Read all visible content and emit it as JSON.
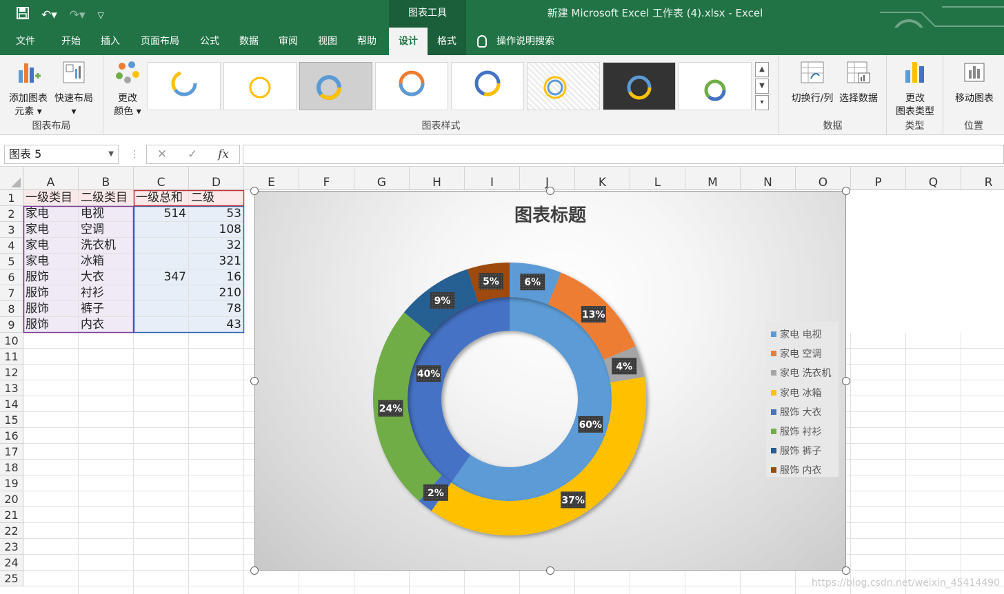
{
  "titlebar": {
    "context_tools": "图表工具",
    "document_title": "新建 Microsoft Excel 工作表 (4).xlsx  -  Excel"
  },
  "tabs": [
    {
      "label": "文件"
    },
    {
      "label": "开始"
    },
    {
      "label": "插入"
    },
    {
      "label": "页面布局"
    },
    {
      "label": "公式"
    },
    {
      "label": "数据"
    },
    {
      "label": "审阅"
    },
    {
      "label": "视图"
    },
    {
      "label": "帮助"
    },
    {
      "label": "设计"
    },
    {
      "label": "格式"
    }
  ],
  "tell_me": "操作说明搜索",
  "ribbon": {
    "add_element_l1": "添加图表",
    "add_element_l2": "元素",
    "quick_layout": "快速布局",
    "group_layout": "图表布局",
    "change_color_l1": "更改",
    "change_color_l2": "颜色",
    "group_styles": "图表样式",
    "switch_rowcol": "切换行/列",
    "select_data": "选择数据",
    "group_data": "数据",
    "change_type_l1": "更改",
    "change_type_l2": "图表类型",
    "group_type": "类型",
    "move_chart": "移动图表",
    "group_location": "位置"
  },
  "formula_bar": {
    "name_box": "图表 5",
    "fx": "fx",
    "formula": ""
  },
  "sheet": {
    "columns": [
      "A",
      "B",
      "C",
      "D",
      "E",
      "F",
      "G",
      "H",
      "I",
      "J",
      "K",
      "L",
      "M",
      "N",
      "O",
      "P",
      "Q",
      "R"
    ],
    "rows": [
      "1",
      "2",
      "3",
      "4",
      "5",
      "6",
      "7",
      "8",
      "9",
      "10",
      "11",
      "12",
      "13",
      "14",
      "15",
      "16",
      "17",
      "18",
      "19",
      "20",
      "21",
      "22",
      "23",
      "24",
      "25"
    ],
    "header": [
      "一级类目",
      "二级类目",
      "一级总和",
      "二级"
    ],
    "data": [
      [
        "家电",
        "电视",
        "514",
        "53"
      ],
      [
        "家电",
        "空调",
        "",
        "108"
      ],
      [
        "家电",
        "洗衣机",
        "",
        "32"
      ],
      [
        "家电",
        "冰箱",
        "",
        "321"
      ],
      [
        "服饰",
        "大衣",
        "347",
        "16"
      ],
      [
        "服饰",
        "衬衫",
        "",
        "210"
      ],
      [
        "服饰",
        "裤子",
        "",
        "78"
      ],
      [
        "服饰",
        "内衣",
        "",
        "43"
      ]
    ]
  },
  "chart_data": {
    "type": "doughnut",
    "title": "图表标题",
    "inner_series": {
      "values": [
        514,
        347
      ],
      "labels": [
        "60%",
        "40%"
      ],
      "colors": [
        "#5b9bd5",
        "#4472c4"
      ]
    },
    "outer_series": {
      "values": [
        53,
        108,
        32,
        321,
        16,
        210,
        78,
        43
      ],
      "labels": [
        "6%",
        "13%",
        "4%",
        "37%",
        "2%",
        "24%",
        "9%",
        "5%"
      ],
      "colors": [
        "#5b9bd5",
        "#ed7d31",
        "#a5a5a5",
        "#ffc000",
        "#4472c4",
        "#70ad47",
        "#255e91",
        "#9e480e"
      ]
    },
    "legend": [
      {
        "label": "家电 电视",
        "color": "#5b9bd5"
      },
      {
        "label": "家电 空调",
        "color": "#ed7d31"
      },
      {
        "label": "家电 洗衣机",
        "color": "#a5a5a5"
      },
      {
        "label": "家电 冰箱",
        "color": "#ffc000"
      },
      {
        "label": "服饰 大衣",
        "color": "#4472c4"
      },
      {
        "label": "服饰 衬衫",
        "color": "#70ad47"
      },
      {
        "label": "服饰 裤子",
        "color": "#255e91"
      },
      {
        "label": "服饰 内衣",
        "color": "#9e480e"
      }
    ],
    "legend_position": "right"
  },
  "watermark": "https://blog.csdn.net/weixin_45414490"
}
